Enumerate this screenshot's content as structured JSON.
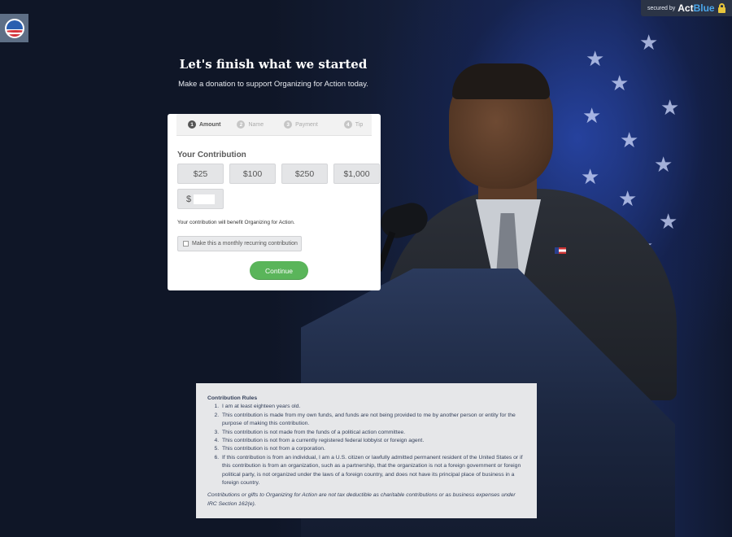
{
  "badge": {
    "secured_text": "secured by",
    "brand_act": "Act",
    "brand_blue": "Blue"
  },
  "header": {
    "title": "Let's finish what we started",
    "subtitle": "Make a donation to support Organizing for Action today."
  },
  "steps": [
    {
      "num": "1",
      "label": "Amount"
    },
    {
      "num": "2",
      "label": "Name"
    },
    {
      "num": "3",
      "label": "Payment"
    },
    {
      "num": "4",
      "label": "Tip"
    }
  ],
  "form": {
    "section_title": "Your Contribution",
    "amounts": [
      "$25",
      "$100",
      "$250",
      "$1,000"
    ],
    "custom_prefix": "$",
    "custom_value": "",
    "benefit_note": "Your contribution will benefit Organizing for Action.",
    "recurring_label": "Make this a monthly recurring contribution",
    "continue_label": "Continue"
  },
  "rules": {
    "title": "Contribution Rules",
    "items": [
      "I am at least eighteen years old.",
      "This contribution is made from my own funds, and funds are not being provided to me by another person or entity for the purpose of making this contribution.",
      "This contribution is not made from the funds of a political action committee.",
      "This contribution is not from a currently registered federal lobbyist or foreign agent.",
      "This contribution is not from a corporation.",
      "If this contribution is from an individual, I am a U.S. citizen or lawfully admitted permanent resident of the United States or if this contribution is from an organization, such as a partnership, that the organization is not a foreign government or foreign political party, is not organized under the laws of a foreign country, and does not have its principal place of business in a foreign country."
    ],
    "note": "Contributions or gifts to Organizing for Action are not tax deductible as charitable contributions or as business expenses under IRC Section 162(e)."
  },
  "colors": {
    "background": "#0f1627",
    "continue_button": "#5ab55a",
    "brand_blue": "#4aa6ea"
  }
}
